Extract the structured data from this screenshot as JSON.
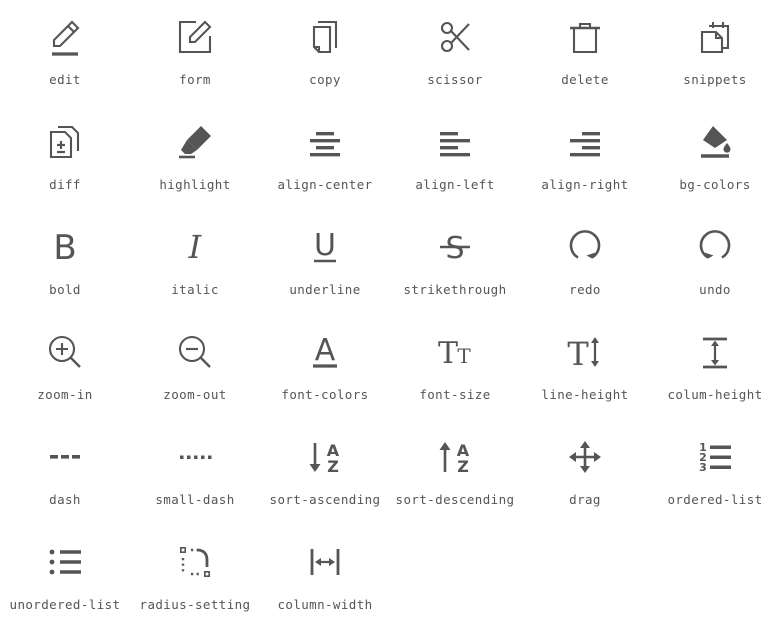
{
  "page": {
    "background_color": "#ffffff",
    "icon_color": "#555555",
    "label_color": "#555555",
    "columns": 6,
    "rows": 6,
    "total_icons": 33
  },
  "icons": [
    {
      "name": "edit-icon",
      "label": "edit"
    },
    {
      "name": "form-icon",
      "label": "form"
    },
    {
      "name": "copy-icon",
      "label": "copy"
    },
    {
      "name": "scissor-icon",
      "label": "scissor"
    },
    {
      "name": "delete-icon",
      "label": "delete"
    },
    {
      "name": "snippets-icon",
      "label": "snippets"
    },
    {
      "name": "diff-icon",
      "label": "diff"
    },
    {
      "name": "highlight-icon",
      "label": "highlight"
    },
    {
      "name": "align-center-icon",
      "label": "align-center"
    },
    {
      "name": "align-left-icon",
      "label": "align-left"
    },
    {
      "name": "align-right-icon",
      "label": "align-right"
    },
    {
      "name": "bg-colors-icon",
      "label": "bg-colors"
    },
    {
      "name": "bold-icon",
      "label": "bold"
    },
    {
      "name": "italic-icon",
      "label": "italic"
    },
    {
      "name": "underline-icon",
      "label": "underline"
    },
    {
      "name": "strikethrough-icon",
      "label": "strikethrough"
    },
    {
      "name": "redo-icon",
      "label": "redo"
    },
    {
      "name": "undo-icon",
      "label": "undo"
    },
    {
      "name": "zoom-in-icon",
      "label": "zoom-in"
    },
    {
      "name": "zoom-out-icon",
      "label": "zoom-out"
    },
    {
      "name": "font-colors-icon",
      "label": "font-colors"
    },
    {
      "name": "font-size-icon",
      "label": "font-size"
    },
    {
      "name": "line-height-icon",
      "label": "line-height"
    },
    {
      "name": "colum-height-icon",
      "label": "colum-height"
    },
    {
      "name": "dash-icon",
      "label": "dash"
    },
    {
      "name": "small-dash-icon",
      "label": "small-dash"
    },
    {
      "name": "sort-ascending-icon",
      "label": "sort-ascending"
    },
    {
      "name": "sort-descending-icon",
      "label": "sort-descending"
    },
    {
      "name": "drag-icon",
      "label": "drag"
    },
    {
      "name": "ordered-list-icon",
      "label": "ordered-list"
    },
    {
      "name": "unordered-list-icon",
      "label": "unordered-list"
    },
    {
      "name": "radius-setting-icon",
      "label": "radius-setting"
    },
    {
      "name": "column-width-icon",
      "label": "column-width"
    }
  ],
  "glyph_text": {
    "bold": "B",
    "italic": "I",
    "underline": "U",
    "strikethrough": "S",
    "font_colors": "A",
    "font_size_big": "T",
    "font_size_small": "T",
    "line_height": "T",
    "sort_a": "A",
    "sort_z": "Z",
    "ordered_one": "1",
    "ordered_two": "2",
    "ordered_three": "3",
    "diff_plus": "+"
  }
}
